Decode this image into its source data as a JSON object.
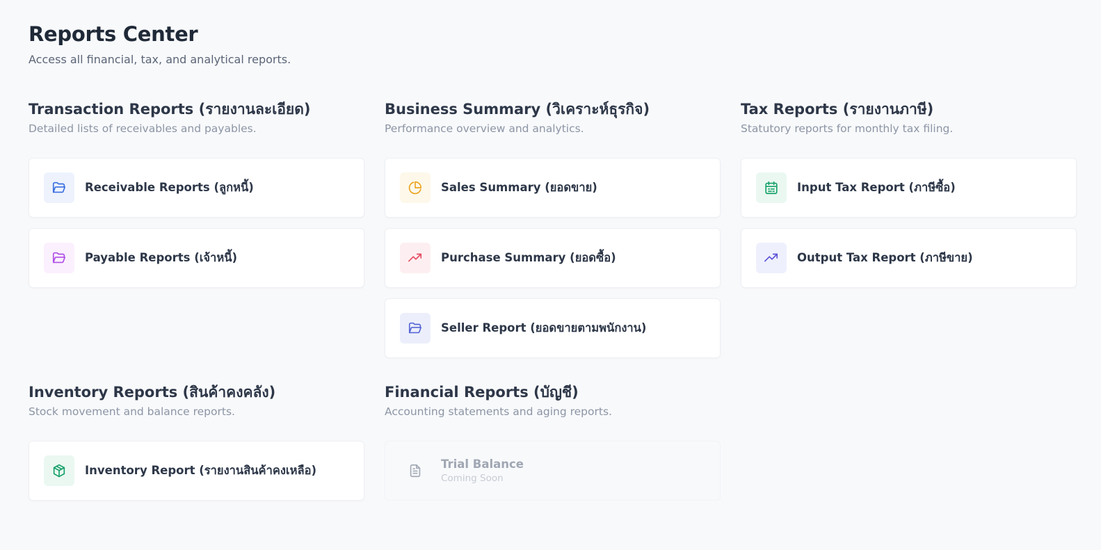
{
  "header": {
    "title": "Reports Center",
    "subtitle": "Access all financial, tax, and analytical reports."
  },
  "sections": [
    {
      "title": "Transaction Reports (รายงานละเอียด)",
      "description": "Detailed lists of receivables and payables.",
      "items": [
        {
          "label": "Receivable Reports (ลูกหนี้)",
          "icon": "folder-open-icon",
          "color": "#3b6fe0"
        },
        {
          "label": "Payable Reports (เจ้าหนี้)",
          "icon": "folder-open-icon",
          "color": "#b04ee6"
        }
      ]
    },
    {
      "title": "Business Summary (วิเคราะห์ธุรกิจ)",
      "description": "Performance overview and analytics.",
      "items": [
        {
          "label": "Sales Summary (ยอดขาย)",
          "icon": "pie-chart-icon",
          "color": "#eba421"
        },
        {
          "label": "Purchase Summary (ยอดซื้อ)",
          "icon": "trending-up-icon",
          "color": "#e64a63"
        },
        {
          "label": "Seller Report (ยอดขายตามพนักงาน)",
          "icon": "folder-open-icon",
          "color": "#5767d6"
        }
      ]
    },
    {
      "title": "Tax Reports (รายงานภาษี)",
      "description": "Statutory reports for monthly tax filing.",
      "items": [
        {
          "label": "Input Tax Report (ภาษีซื้อ)",
          "icon": "calendar-icon",
          "color": "#16a06a"
        },
        {
          "label": "Output Tax Report (ภาษีขาย)",
          "icon": "trending-up-icon",
          "color": "#5a50d8"
        }
      ]
    },
    {
      "title": "Inventory Reports (สินค้าคงคลัง)",
      "description": "Stock movement and balance reports.",
      "items": [
        {
          "label": "Inventory Report (รายงานสินค้าคงเหลือ)",
          "icon": "box-icon",
          "color": "#16a06a"
        }
      ]
    },
    {
      "title": "Financial Reports (บัญชี)",
      "description": "Accounting statements and aging reports.",
      "items": [
        {
          "label": "Trial Balance",
          "sublabel": "Coming Soon",
          "icon": "document-icon",
          "color": "#a3aab6",
          "disabled": true
        }
      ]
    }
  ]
}
